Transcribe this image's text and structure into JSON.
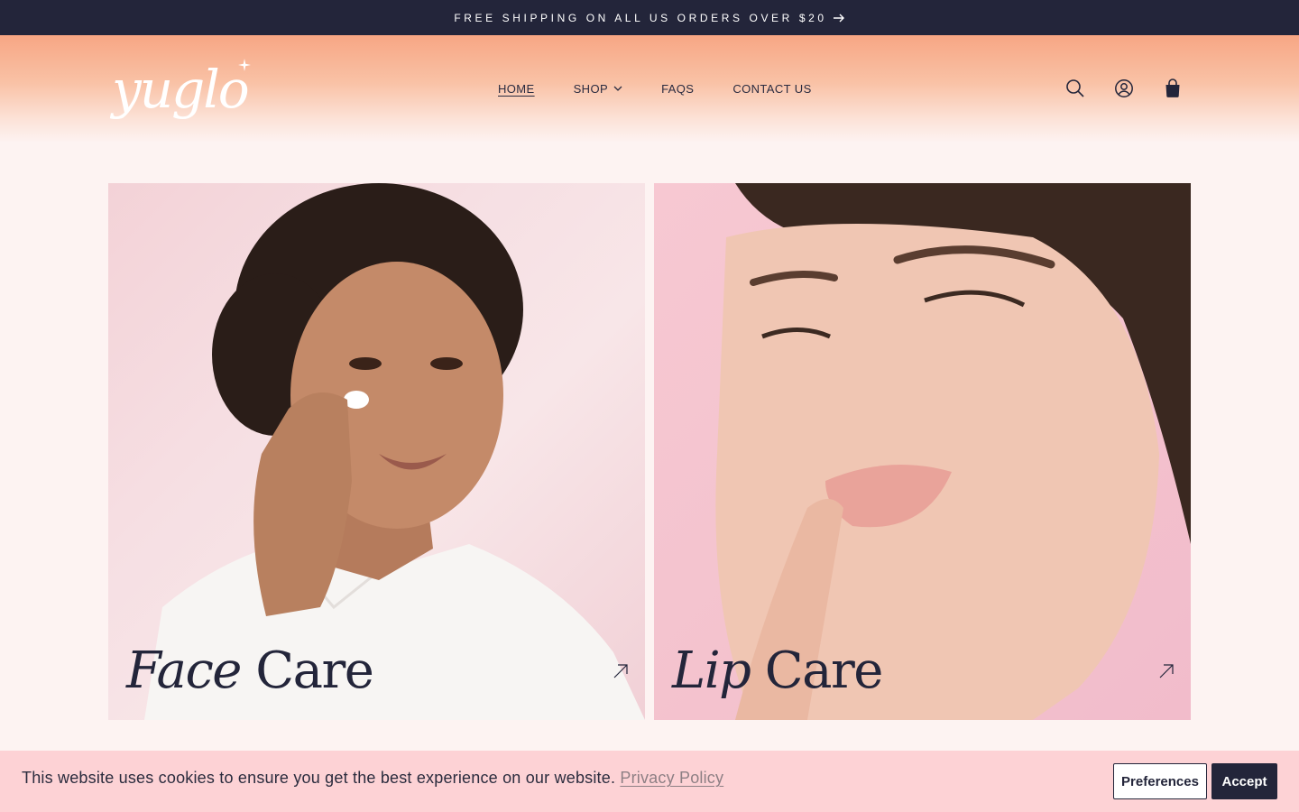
{
  "announcement": {
    "text": "FREE SHIPPING ON ALL US ORDERS OVER $20",
    "icon": "arrow-right-icon"
  },
  "header": {
    "logo_text": "yuglo",
    "nav": [
      {
        "label": "HOME",
        "active": true
      },
      {
        "label": "SHOP",
        "has_dropdown": true
      },
      {
        "label": "FAQS"
      },
      {
        "label": "CONTACT US"
      }
    ],
    "icons": [
      "search-icon",
      "account-icon",
      "cart-icon"
    ]
  },
  "cards": [
    {
      "title_italic": "Face",
      "title_rest": "Care",
      "icon": "arrow-up-right-icon"
    },
    {
      "title_italic": "Lip",
      "title_rest": "Care",
      "icon": "arrow-up-right-icon"
    }
  ],
  "cookie": {
    "message": "This website uses cookies to ensure you get the best experience on our website.",
    "link": "Privacy Policy",
    "preferences_label": "Preferences",
    "accept_label": "Accept"
  },
  "colors": {
    "announcement_bg": "#23253a",
    "header_gradient_top": "#f7a684",
    "page_bg": "#fdf3f2",
    "cookie_bg": "#fdd2d5",
    "dark": "#23253a"
  }
}
